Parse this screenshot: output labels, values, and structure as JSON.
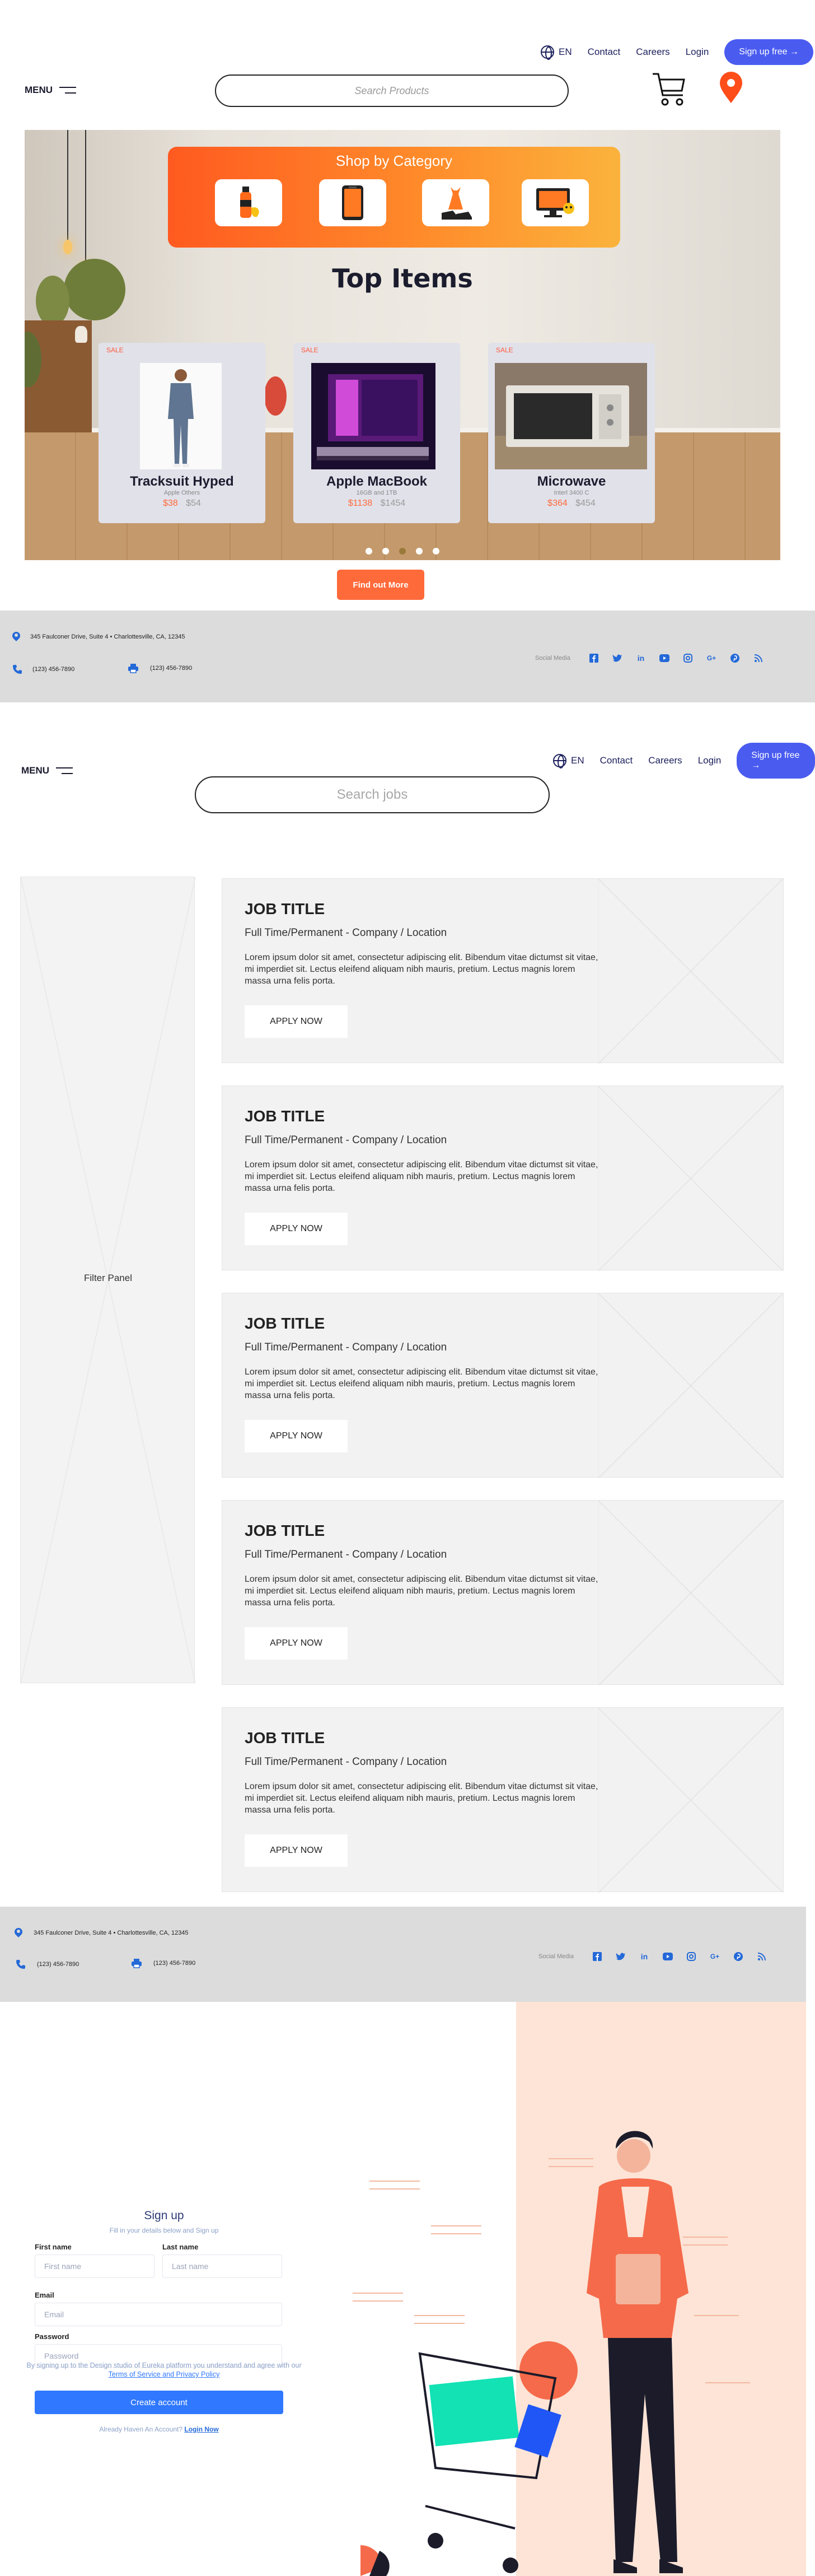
{
  "shop_nav": {
    "lang": "EN",
    "links": [
      "Contact",
      "Careers",
      "Login"
    ],
    "signup": "Sign up free →",
    "menu": "MENU",
    "search_placeholder": "Search Products"
  },
  "hero": {
    "category_title": "Shop by Category",
    "categories": [
      {
        "name": "groceries",
        "icon": "bottle-icon"
      },
      {
        "name": "phones",
        "icon": "smartphone-icon"
      },
      {
        "name": "fashion",
        "icon": "dress-icon"
      },
      {
        "name": "electronics",
        "icon": "monitor-icon"
      }
    ],
    "top_items_title": "Top Items",
    "products": [
      {
        "sale": "SALE",
        "name": "Tracksuit Hyped",
        "sub": "Apple Others",
        "price": "$38",
        "old_price": "$54"
      },
      {
        "sale": "SALE",
        "name": "Apple MacBook",
        "sub": "16GB and 1TB",
        "price": "$1138",
        "old_price": "$1454"
      },
      {
        "sale": "SALE",
        "name": "Microwave",
        "sub": "Interl 3400 C",
        "price": "$364",
        "old_price": "$454"
      }
    ],
    "carousel_dots": 5,
    "active_dot": 3,
    "find_button": "Find out More"
  },
  "footer": {
    "address": "345 Faulconer Drive, Suite 4 • Charlottesville, CA, 12345",
    "phone": "(123) 456-7890",
    "fax": "(123) 456-7890",
    "social_label": "Social Media",
    "social": [
      "facebook-icon",
      "twitter-icon",
      "linkedin-icon",
      "youtube-icon",
      "instagram-icon",
      "google-plus-icon",
      "pinterest-icon",
      "rss-icon"
    ]
  },
  "jobs_nav": {
    "lang": "EN",
    "links": [
      "Contact",
      "Careers",
      "Login"
    ],
    "signup": "Sign up free →",
    "menu": "MENU",
    "search_placeholder": "Search  jobs"
  },
  "filter_panel": "Filter Panel",
  "jobs": [
    {
      "title": "JOB TITLE",
      "sub": "Full Time/Permanent - Company / Location",
      "desc": "Lorem ipsum dolor sit amet, consectetur adipiscing elit. Bibendum vitae dictumst sit vitae, mi imperdiet sit. Lectus eleifend aliquam nibh mauris, pretium. Lectus magnis lorem massa urna felis porta.",
      "apply": "APPLY NOW"
    },
    {
      "title": "JOB TITLE",
      "sub": "Full Time/Permanent - Company / Location",
      "desc": "Lorem ipsum dolor sit amet, consectetur adipiscing elit. Bibendum vitae dictumst sit vitae, mi imperdiet sit. Lectus eleifend aliquam nibh mauris, pretium. Lectus magnis lorem massa urna felis porta.",
      "apply": "APPLY NOW"
    },
    {
      "title": "JOB TITLE",
      "sub": "Full Time/Permanent - Company / Location",
      "desc": "Lorem ipsum dolor sit amet, consectetur adipiscing elit. Bibendum vitae dictumst sit vitae, mi imperdiet sit. Lectus eleifend aliquam nibh mauris, pretium. Lectus magnis lorem massa urna felis porta.",
      "apply": "APPLY NOW"
    },
    {
      "title": "JOB TITLE",
      "sub": "Full Time/Permanent - Company / Location",
      "desc": "Lorem ipsum dolor sit amet, consectetur adipiscing elit. Bibendum vitae dictumst sit vitae, mi imperdiet sit. Lectus eleifend aliquam nibh mauris, pretium. Lectus magnis lorem massa urna felis porta.",
      "apply": "APPLY NOW"
    },
    {
      "title": "JOB TITLE",
      "sub": "Full Time/Permanent - Company / Location",
      "desc": "Lorem ipsum dolor sit amet, consectetur adipiscing elit. Bibendum vitae dictumst sit vitae, mi imperdiet sit. Lectus eleifend aliquam nibh mauris, pretium. Lectus magnis lorem massa urna felis porta.",
      "apply": "APPLY NOW"
    }
  ],
  "signup": {
    "title": "Sign up",
    "subtitle": "Fill in your details below and Sign up",
    "first_name_label": "First name",
    "first_name_placeholder": "First name",
    "last_name_label": "Last name",
    "last_name_placeholder": "Last name",
    "email_label": "Email",
    "email_placeholder": "Email",
    "password_label": "Password",
    "password_placeholder": "Password",
    "terms_prefix": "By signing up to the Design studio of Eureka platform you understand and agree with our ",
    "terms_link": "Terms of Service and Privacy Policy",
    "create_button": "Create account",
    "already_text": "Already Haven An Account?",
    "login_link": "Login Now"
  },
  "colors": {
    "accent_blue": "#4a5cf0",
    "orange": "#ff6a3a",
    "footer_bg": "#dcdcdc",
    "link_blue": "#2469d8",
    "peach": "#fde4d6"
  }
}
